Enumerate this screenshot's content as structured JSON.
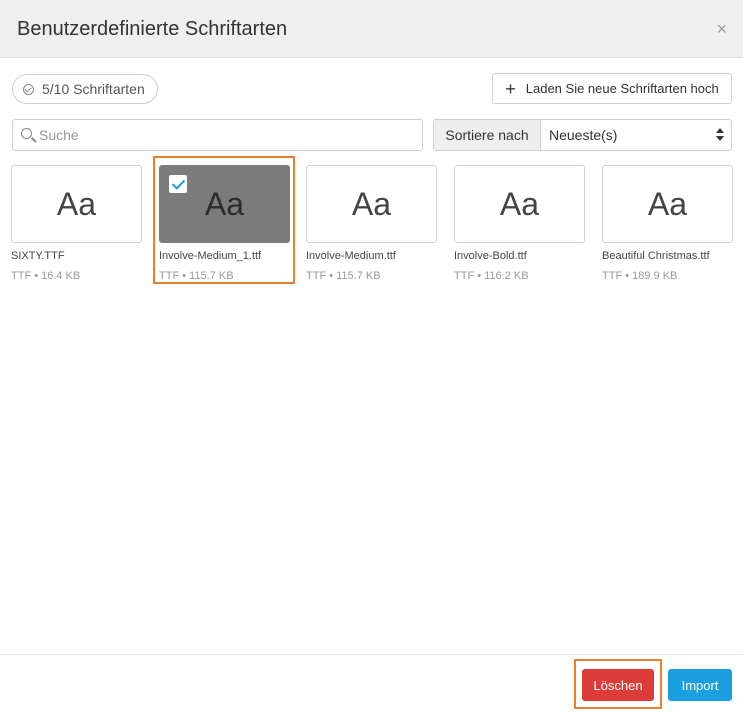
{
  "dialog": {
    "title": "Benutzerdefinierte Schriftarten",
    "close_label": "×"
  },
  "toolbar": {
    "count_label": "5/10 Schriftarten",
    "upload_plus": "+",
    "upload_label": "Laden Sie neue Schriftarten hoch"
  },
  "search": {
    "placeholder": "Suche",
    "value": ""
  },
  "sort": {
    "label": "Sortiere nach",
    "selected": "Neueste(s)"
  },
  "fonts": [
    {
      "preview": "Aa",
      "name": "SIXTY.TTF",
      "meta": "TTF • 16.4 KB",
      "selected": false
    },
    {
      "preview": "Aa",
      "name": "Involve-Medium_1.ttf",
      "meta": "TTF • 115.7 KB",
      "selected": true
    },
    {
      "preview": "Aa",
      "name": "Involve-Medium.ttf",
      "meta": "TTF • 115.7 KB",
      "selected": false
    },
    {
      "preview": "Aa",
      "name": "Involve-Bold.ttf",
      "meta": "TTF • 116.2 KB",
      "selected": false
    },
    {
      "preview": "Aa",
      "name": "Beautiful Christmas.ttf",
      "meta": "TTF • 189.9 KB",
      "selected": false
    }
  ],
  "footer": {
    "delete_label": "Löschen",
    "import_label": "Import"
  },
  "colors": {
    "highlight": "#ec7e2c",
    "delete": "#dc3b37",
    "primary": "#1a9fe0"
  }
}
